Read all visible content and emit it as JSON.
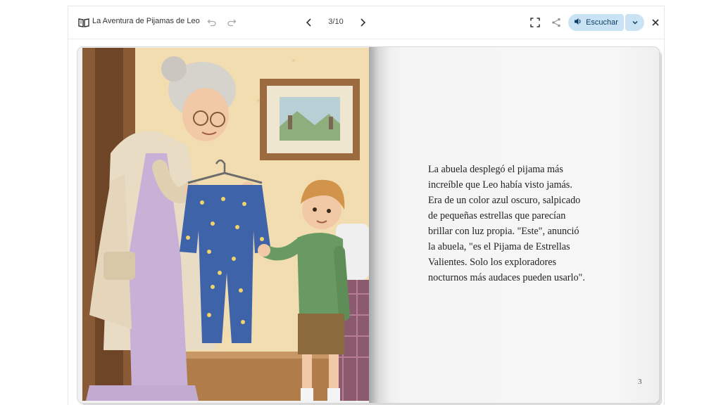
{
  "toolbar": {
    "book_title": "La Aventura de Pijamas de Leo",
    "page_counter": "3/10",
    "listen_label": "Escuchar"
  },
  "page": {
    "text_lines": [
      "La abuela desplegó el pijama más",
      "increíble que Leo había visto jamás.",
      "Era de un color azul oscuro, salpicado",
      "de pequeñas estrellas que parecían",
      "brillar con luz propia. \"Este\", anunció",
      "la abuela, \"es el Pijama de Estrellas",
      "Valientes. Solo los exploradores",
      "nocturnos más audaces pueden usarlo\"."
    ],
    "page_number": "3"
  },
  "colors": {
    "accent": "#c9e3f5",
    "accent_text": "#0b3d66"
  },
  "icons": [
    "book-icon",
    "undo-icon",
    "redo-icon",
    "chevron-left-icon",
    "chevron-right-icon",
    "fullscreen-icon",
    "share-icon",
    "speaker-icon",
    "chevron-down-icon",
    "close-icon"
  ]
}
